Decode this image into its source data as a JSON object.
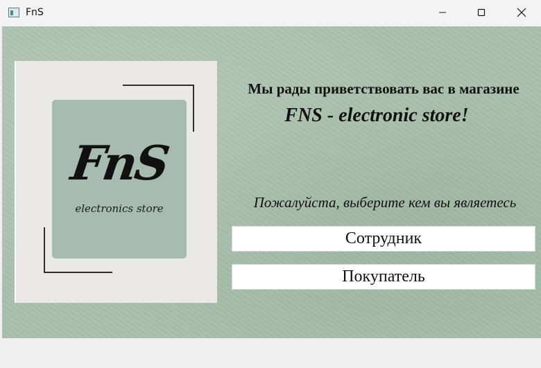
{
  "window": {
    "title": "FnS",
    "controls": {
      "minimize_icon": "minimize-icon",
      "maximize_icon": "maximize-icon",
      "close_icon": "close-icon"
    }
  },
  "logo": {
    "brand": "FnS",
    "tagline": "electronics store"
  },
  "main": {
    "welcome": "Мы рады приветствовать вас в магазине",
    "store_name": "FNS - electronic store!",
    "prompt": "Пожалуйста, выберите кем вы являетесь",
    "buttons": {
      "employee": "Сотрудник",
      "customer": "Покупатель"
    }
  },
  "colors": {
    "background": "#a9c0ad",
    "logo_panel": "#a6bcb0",
    "card": "#ebe9e5"
  }
}
